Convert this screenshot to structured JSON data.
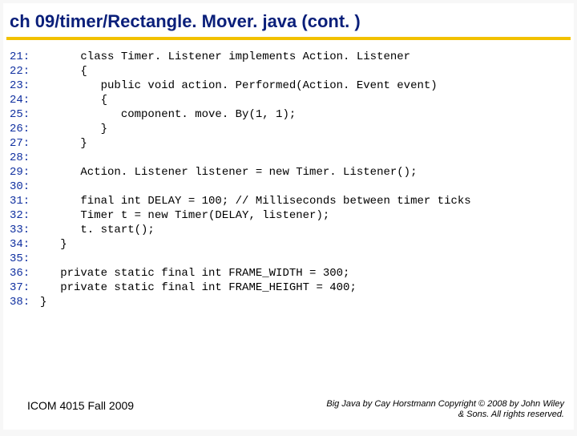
{
  "title": "ch 09/timer/Rectangle. Mover. java  (cont. )",
  "code": [
    {
      "n": "21:",
      "t": "      class Timer. Listener implements Action. Listener"
    },
    {
      "n": "22:",
      "t": "      {"
    },
    {
      "n": "23:",
      "t": "         public void action. Performed(Action. Event event)"
    },
    {
      "n": "24:",
      "t": "         {"
    },
    {
      "n": "25:",
      "t": "            component. move. By(1, 1);"
    },
    {
      "n": "26:",
      "t": "         }"
    },
    {
      "n": "27:",
      "t": "      }"
    },
    {
      "n": "28:",
      "t": ""
    },
    {
      "n": "29:",
      "t": "      Action. Listener listener = new Timer. Listener();"
    },
    {
      "n": "30:",
      "t": ""
    },
    {
      "n": "31:",
      "t": "      final int DELAY = 100; // Milliseconds between timer ticks"
    },
    {
      "n": "32:",
      "t": "      Timer t = new Timer(DELAY, listener);"
    },
    {
      "n": "33:",
      "t": "      t. start();"
    },
    {
      "n": "34:",
      "t": "   }"
    },
    {
      "n": "35:",
      "t": ""
    },
    {
      "n": "36:",
      "t": "   private static final int FRAME_WIDTH = 300;"
    },
    {
      "n": "37:",
      "t": "   private static final int FRAME_HEIGHT = 400;"
    },
    {
      "n": "38:",
      "t": "}"
    }
  ],
  "footer": {
    "left": "ICOM 4015 Fall 2009",
    "right1": "Big Java by Cay Horstmann Copyright © 2008 by John Wiley",
    "right2": "& Sons.  All rights reserved."
  }
}
